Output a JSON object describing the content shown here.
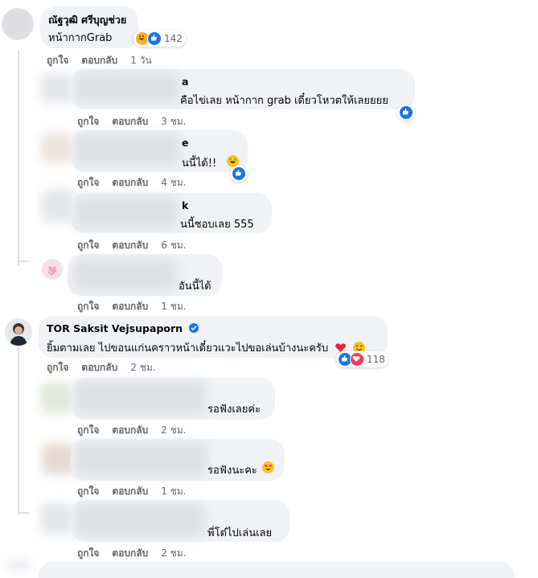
{
  "comments": [
    {
      "author": "ณัฐวุฒิ ศรีบุญช่วย",
      "text": "หน้ากากGrab",
      "reaction_count": "142",
      "time": "1 วัน"
    },
    {
      "author_visible": "a",
      "text_visible": "คือไข่เลย หน้ากาก grab เดี๋ยวโหวตให้เลยยยย",
      "time": "3 ชม."
    },
    {
      "author_visible": "e",
      "text_visible": "นนี้ได้!!",
      "time": "4 ชม."
    },
    {
      "author_visible": "k",
      "text_visible": "นนี้ชอบเลย 555",
      "time": "6 ชม."
    },
    {
      "text_visible": "อันนี้ได้",
      "time": "1 ชม."
    },
    {
      "author": "TOR Saksit Vejsupaporn",
      "text": "ยิ้มตามเลย ไปขอนแก่นคราวหน้าเดี๋ยวแวะไปขอเล่นบ้างนะครับ",
      "reaction_count": "118",
      "time": "2 ชม."
    },
    {
      "text_visible": "รอฟังเลยค่ะ",
      "time": "2 ชม."
    },
    {
      "text_visible": "รอฟังนะคะ",
      "time": "1 ชม."
    },
    {
      "text_visible": "พี่โต๋ไปเล่นเลย",
      "time": "2 ชม."
    }
  ],
  "actions": {
    "like": "ถูกใจ",
    "reply": "ตอบกลับ"
  },
  "colors": {
    "bubble": "#f0f2f5",
    "meta": "#65676b",
    "like": "#1b74e4",
    "love": "#f33e58",
    "haha": "#f7b125"
  }
}
